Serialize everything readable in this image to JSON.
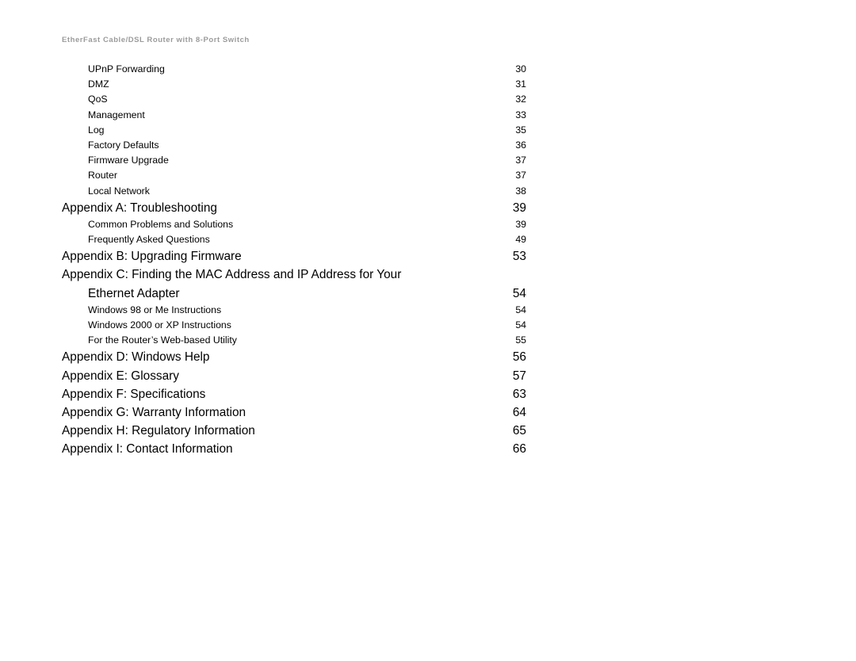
{
  "header": {
    "running_title": "EtherFast Cable/DSL Router with 8-Port Switch"
  },
  "toc": {
    "entries": [
      {
        "level": "sub",
        "title": "UPnP Forwarding",
        "page": "30"
      },
      {
        "level": "sub",
        "title": "DMZ",
        "page": "31"
      },
      {
        "level": "sub",
        "title": "QoS",
        "page": "32"
      },
      {
        "level": "sub",
        "title": "Management",
        "page": "33"
      },
      {
        "level": "sub",
        "title": "Log",
        "page": "35"
      },
      {
        "level": "sub",
        "title": "Factory Defaults",
        "page": "36"
      },
      {
        "level": "sub",
        "title": "Firmware Upgrade",
        "page": "37"
      },
      {
        "level": "sub",
        "title": "Router",
        "page": "37"
      },
      {
        "level": "sub",
        "title": "Local Network",
        "page": "38"
      },
      {
        "level": "main",
        "title": "Appendix A: Troubleshooting",
        "page": "39"
      },
      {
        "level": "sub",
        "title": "Common Problems and Solutions",
        "page": "39"
      },
      {
        "level": "sub",
        "title": "Frequently Asked Questions",
        "page": "49"
      },
      {
        "level": "main",
        "title": "Appendix B: Upgrading Firmware",
        "page": "53"
      },
      {
        "level": "main",
        "title": "Appendix C: Finding the MAC Address and IP Address for Your",
        "page": "",
        "wrap_first": true
      },
      {
        "level": "main",
        "title": "Ethernet Adapter",
        "page": "54",
        "continuation": true
      },
      {
        "level": "sub",
        "title": "Windows 98 or Me Instructions",
        "page": "54"
      },
      {
        "level": "sub",
        "title": "Windows 2000 or XP Instructions",
        "page": "54"
      },
      {
        "level": "sub",
        "title": "For the Router’s Web-based Utility",
        "page": "55"
      },
      {
        "level": "main",
        "title": "Appendix D: Windows Help",
        "page": "56"
      },
      {
        "level": "main",
        "title": "Appendix E: Glossary",
        "page": "57"
      },
      {
        "level": "main",
        "title": "Appendix F: Specifications",
        "page": "63"
      },
      {
        "level": "main",
        "title": "Appendix G: Warranty Information",
        "page": "64"
      },
      {
        "level": "main",
        "title": "Appendix H: Regulatory Information",
        "page": "65"
      },
      {
        "level": "main",
        "title": "Appendix I: Contact Information",
        "page": "66"
      }
    ]
  }
}
